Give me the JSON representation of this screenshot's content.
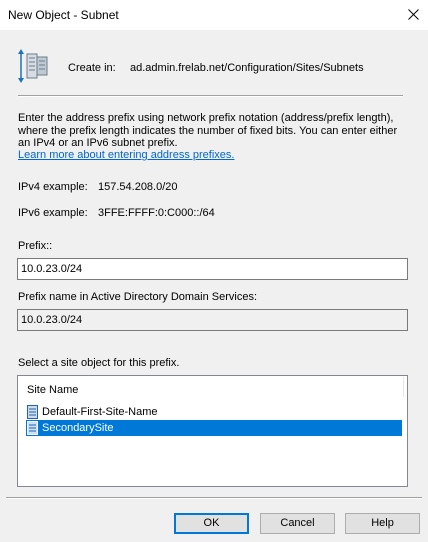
{
  "window": {
    "title": "New Object - Subnet",
    "close_icon": "close-icon"
  },
  "header": {
    "icon": "subnet-object-icon",
    "create_in_label": "Create in:",
    "create_in_path": "ad.admin.frelab.net/Configuration/Sites/Subnets"
  },
  "description": {
    "text": "Enter the address prefix using network prefix notation (address/prefix length), where the prefix length indicates the number of fixed bits. You can enter either an IPv4 or an IPv6 subnet prefix.",
    "link": "Learn more about entering address prefixes."
  },
  "examples": {
    "ipv4_label": "IPv4 example:",
    "ipv4_value": "157.54.208.0/20",
    "ipv6_label": "IPv6 example:",
    "ipv6_value": "3FFE:FFFF:0:C000::/64"
  },
  "prefix": {
    "label": "Prefix::",
    "value": "10.0.23.0/24"
  },
  "ad_prefix": {
    "label": "Prefix name in Active Directory Domain Services:",
    "value": "10.0.23.0/24"
  },
  "sites": {
    "label": "Select a site object for this prefix.",
    "column_header": "Site Name",
    "items": [
      {
        "name": "Default-First-Site-Name",
        "icon": "site-icon",
        "selected": false
      },
      {
        "name": "SecondarySite",
        "icon": "site-icon",
        "selected": true
      }
    ]
  },
  "buttons": {
    "ok": "OK",
    "cancel": "Cancel",
    "help": "Help"
  },
  "colors": {
    "selection": "#0078d7",
    "link": "#0066cc",
    "window_bg": "#f0f0f0"
  }
}
